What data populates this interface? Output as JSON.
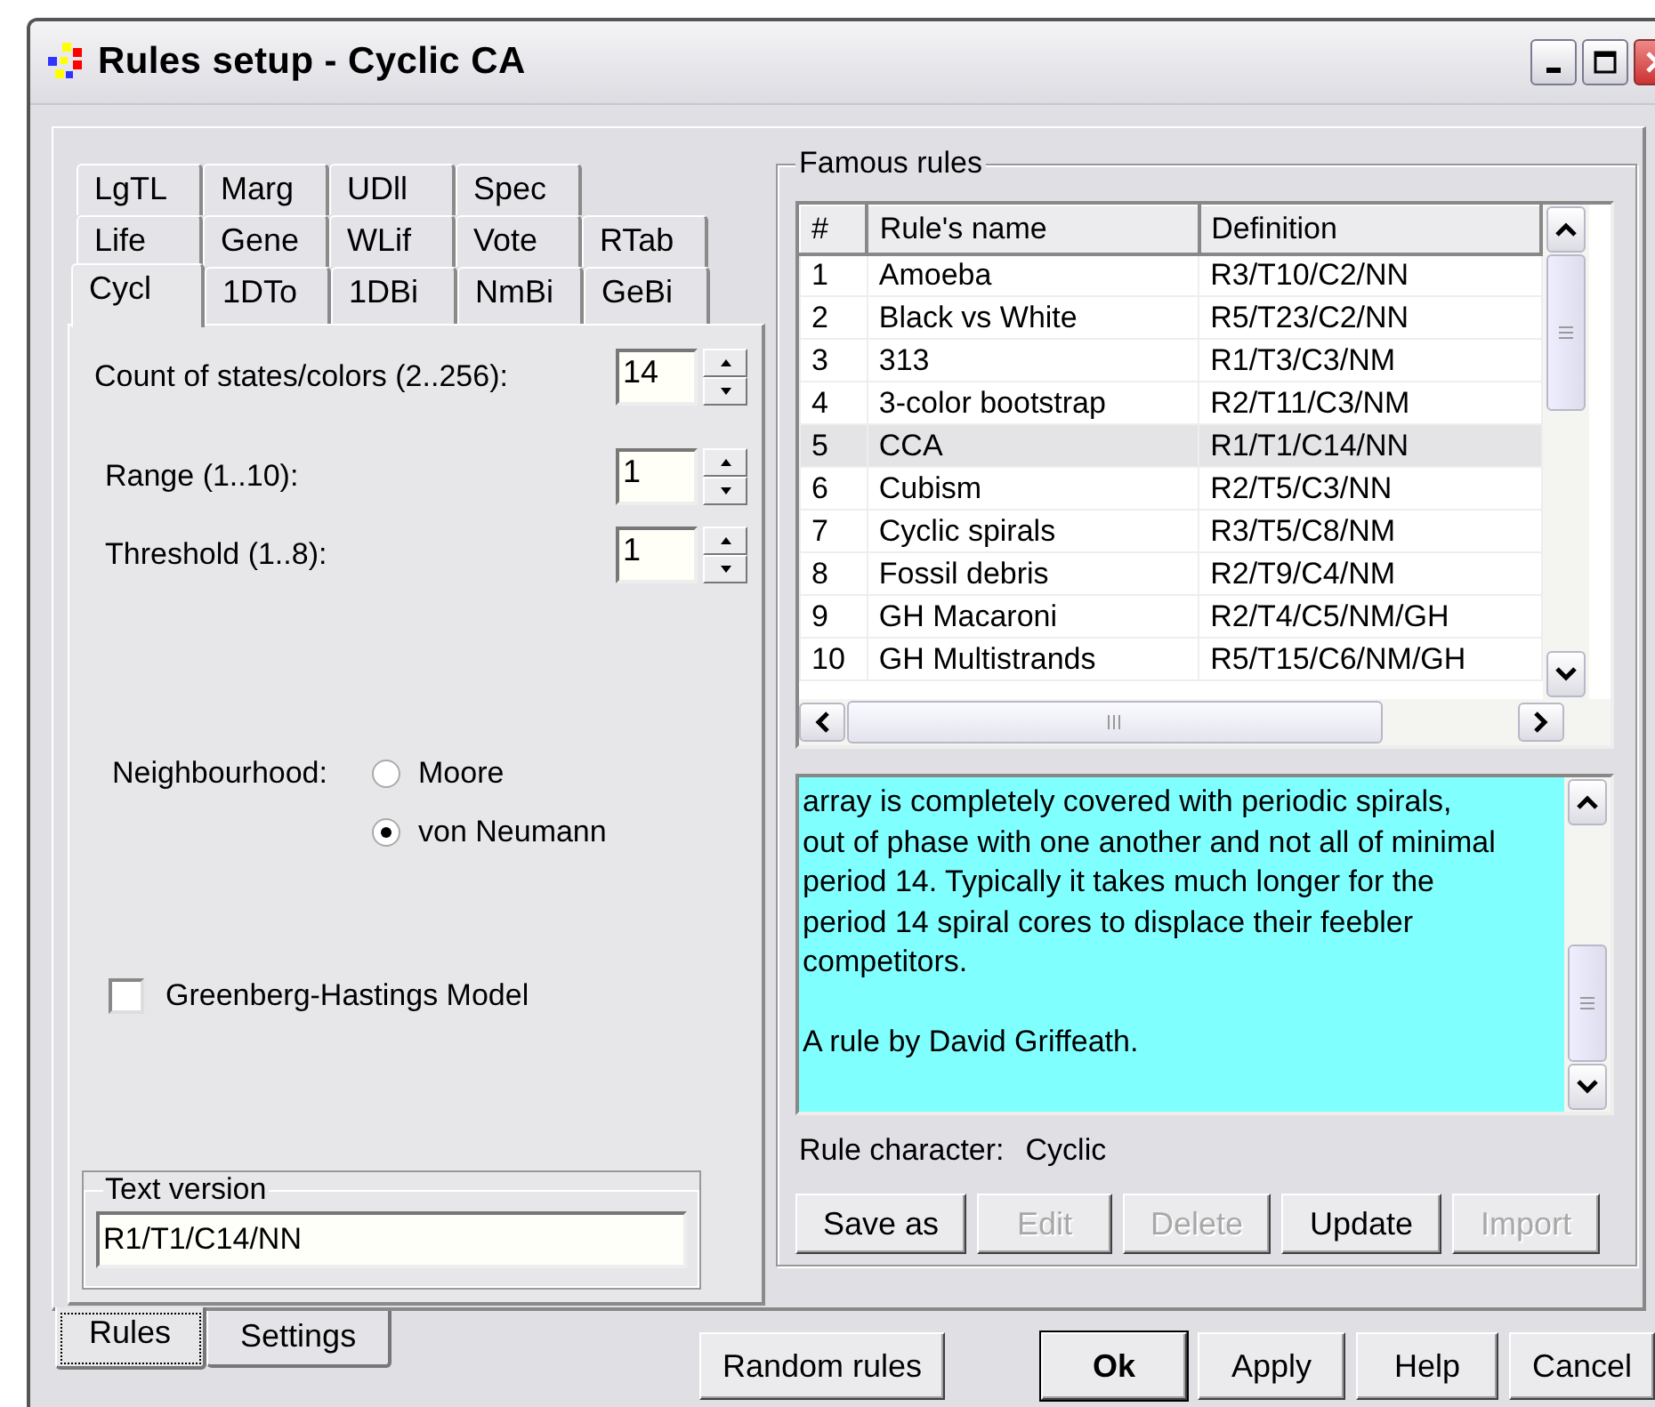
{
  "window": {
    "title": "Rules setup - Cyclic CA"
  },
  "rule_families": {
    "rows": [
      [
        {
          "label": "LgTL",
          "selected": false
        },
        {
          "label": "Marg",
          "selected": false
        },
        {
          "label": "UDll",
          "selected": false
        },
        {
          "label": "Spec",
          "selected": false
        }
      ],
      [
        {
          "label": "Life",
          "selected": false
        },
        {
          "label": "Gene",
          "selected": false
        },
        {
          "label": "WLif",
          "selected": false
        },
        {
          "label": "Vote",
          "selected": false
        },
        {
          "label": "RTab",
          "selected": false
        }
      ],
      [
        {
          "label": "Cycl",
          "selected": true
        },
        {
          "label": "1DTo",
          "selected": false
        },
        {
          "label": "1DBi",
          "selected": false
        },
        {
          "label": "NmBi",
          "selected": false
        },
        {
          "label": "GeBi",
          "selected": false
        }
      ]
    ]
  },
  "settings": {
    "spinners": [
      {
        "label": "Count of states/colors (2..256):",
        "value": "14"
      },
      {
        "label": "Range (1..10):",
        "value": "1"
      },
      {
        "label": "Threshold (1..8):",
        "value": "1"
      }
    ],
    "neighbourhood": {
      "label": "Neighbourhood:",
      "options": [
        {
          "label": "Moore",
          "selected": false
        },
        {
          "label": "von Neumann",
          "selected": true
        }
      ]
    },
    "greenberg_hastings": {
      "label": "Greenberg-Hastings Model",
      "checked": false
    },
    "text_version": {
      "legend": "Text version",
      "value": "R1/T1/C14/NN"
    }
  },
  "famous_rules": {
    "legend": "Famous rules",
    "columns": [
      "#",
      "Rule's name",
      "Definition"
    ],
    "rows": [
      {
        "number": "1",
        "name": "Amoeba",
        "definition": "R3/T10/C2/NN",
        "selected": false
      },
      {
        "number": "2",
        "name": "Black vs White",
        "definition": "R5/T23/C2/NN",
        "selected": false
      },
      {
        "number": "3",
        "name": "313",
        "definition": "R1/T3/C3/NM",
        "selected": false
      },
      {
        "number": "4",
        "name": "3-color bootstrap",
        "definition": "R2/T11/C3/NM",
        "selected": false
      },
      {
        "number": "5",
        "name": "CCA",
        "definition": "R1/T1/C14/NN",
        "selected": true
      },
      {
        "number": "6",
        "name": "Cubism",
        "definition": "R2/T5/C3/NN",
        "selected": false
      },
      {
        "number": "7",
        "name": "Cyclic spirals",
        "definition": "R3/T5/C8/NM",
        "selected": false
      },
      {
        "number": "8",
        "name": "Fossil debris",
        "definition": "R2/T9/C4/NM",
        "selected": false
      },
      {
        "number": "9",
        "name": "GH Macaroni",
        "definition": "R2/T4/C5/NM/GH",
        "selected": false
      },
      {
        "number": "10",
        "name": "GH Multistrands",
        "definition": "R5/T15/C6/NM/GH",
        "selected": false
      }
    ],
    "description": [
      "array is completely covered with periodic spirals, out of phase with one another and not all of minimal period 14. Typically it takes much longer for the period 14 spiral cores to displace their feebler competitors.",
      "A rule by David Griffeath."
    ],
    "rule_character": {
      "label": "Rule character:",
      "value": "Cyclic"
    },
    "buttons": [
      {
        "label": "Save as",
        "disabled": false
      },
      {
        "label": "Edit",
        "disabled": true
      },
      {
        "label": "Delete",
        "disabled": true
      },
      {
        "label": "Update",
        "disabled": false
      },
      {
        "label": "Import",
        "disabled": true
      }
    ]
  },
  "page_tabs": [
    {
      "label": "Rules",
      "selected": true
    },
    {
      "label": "Settings",
      "selected": false
    }
  ],
  "buttons": [
    {
      "label": "Random rules",
      "kind": "normal"
    },
    {
      "label": "Ok",
      "kind": "default"
    },
    {
      "label": "Apply",
      "kind": "normal"
    },
    {
      "label": "Help",
      "kind": "normal"
    },
    {
      "label": "Cancel",
      "kind": "normal"
    }
  ]
}
